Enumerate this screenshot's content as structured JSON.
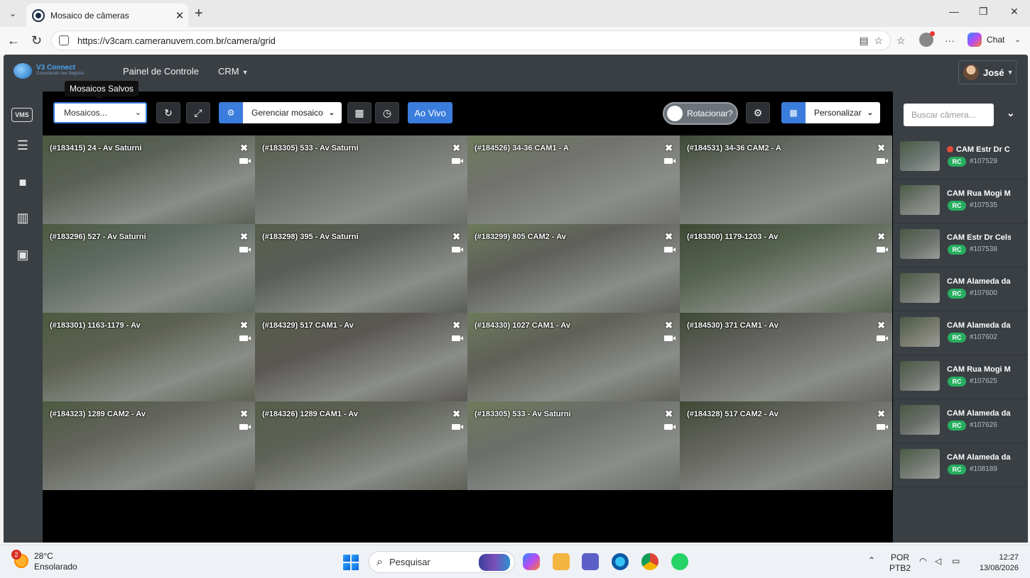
{
  "browser": {
    "tab_title": "Mosaico de câmeras",
    "url": "https://v3cam.cameranuvem.com.br/camera/grid",
    "chat_label": "Chat"
  },
  "app": {
    "logo_title": "V3 Connect",
    "logo_subtitle": "Conectando seu Negócio",
    "nav": {
      "painel": "Painel de Controle",
      "crm": "CRM"
    },
    "user_name": "José",
    "sidebar": {
      "vms_label": "VMS"
    },
    "tooltip": "Mosaicos Salvos",
    "toolbar": {
      "mosaic_select": "Mosaicos...",
      "manage_mosaic": "Gerenciar mosaico",
      "live": "Ao Vivo",
      "rotate": "Rotacionar?",
      "customize": "Personalizar"
    },
    "grid": [
      {
        "label": "(#183415) 24 - Av Saturni",
        "bg": "#5a6057"
      },
      {
        "label": "(#183305) 533 - Av Saturni",
        "bg": "#6b6e6a"
      },
      {
        "label": "(#184526) 34-36 CAM1 - A",
        "bg": "#71726e"
      },
      {
        "label": "(#184531) 34-36 CAM2 - A",
        "bg": "#6a6e69"
      },
      {
        "label": "(#183296) 527 - Av Saturni",
        "bg": "#5f6a64"
      },
      {
        "label": "(#183298) 395 - Av Saturni",
        "bg": "#5b5d59"
      },
      {
        "label": "(#183299) 805 CAM2 - Av",
        "bg": "#5e5f5a"
      },
      {
        "label": "(#183300) 1179-1203 - Av",
        "bg": "#56634e"
      },
      {
        "label": "(#183301) 1163-1179 - Av",
        "bg": "#5d6152"
      },
      {
        "label": "(#184329) 517 CAM1 - Av",
        "bg": "#5a5753"
      },
      {
        "label": "(#184330) 1027 CAM1 - Av",
        "bg": "#5f6058"
      },
      {
        "label": "(#184530) 371 CAM1 - Av",
        "bg": "#646361"
      },
      {
        "label": "(#184323) 1289 CAM2 - Av",
        "bg": "#63645d"
      },
      {
        "label": "(#184326) 1289 CAM1 - Av",
        "bg": "#5e6157"
      },
      {
        "label": "(#183305) 533 - Av Saturni",
        "bg": "#6b6e6a"
      },
      {
        "label": "(#184328) 517 CAM2 - Av",
        "bg": "#65655f"
      }
    ],
    "camlist": {
      "search_placeholder": "Buscar câmera...",
      "items": [
        {
          "name": "CAM Estr Dr C",
          "id": "#107529",
          "rc": "RC",
          "recording": true
        },
        {
          "name": "CAM Rua Mogi M",
          "id": "#107535",
          "rc": "RC"
        },
        {
          "name": "CAM Estr Dr Cels",
          "id": "#107538",
          "rc": "RC"
        },
        {
          "name": "CAM Alameda da",
          "id": "#107600",
          "rc": "RC"
        },
        {
          "name": "CAM Alameda da",
          "id": "#107602",
          "rc": "RC"
        },
        {
          "name": "CAM Rua Mogi M",
          "id": "#107625",
          "rc": "RC"
        },
        {
          "name": "CAM Alameda da",
          "id": "#107626",
          "rc": "RC"
        },
        {
          "name": "CAM Alameda da",
          "id": "#108189",
          "rc": "RC"
        }
      ]
    }
  },
  "taskbar": {
    "weather_temp": "28°C",
    "weather_desc": "Ensolarado",
    "weather_badge": "2",
    "search_label": "Pesquisar",
    "lang_line1": "POR",
    "lang_line2": "PTB2",
    "time": "12:27",
    "date": "13/08/2026"
  },
  "colors": {
    "accent": "#3b7ddd",
    "rc_badge": "#27ae60",
    "app_bar": "#3a3f44"
  }
}
